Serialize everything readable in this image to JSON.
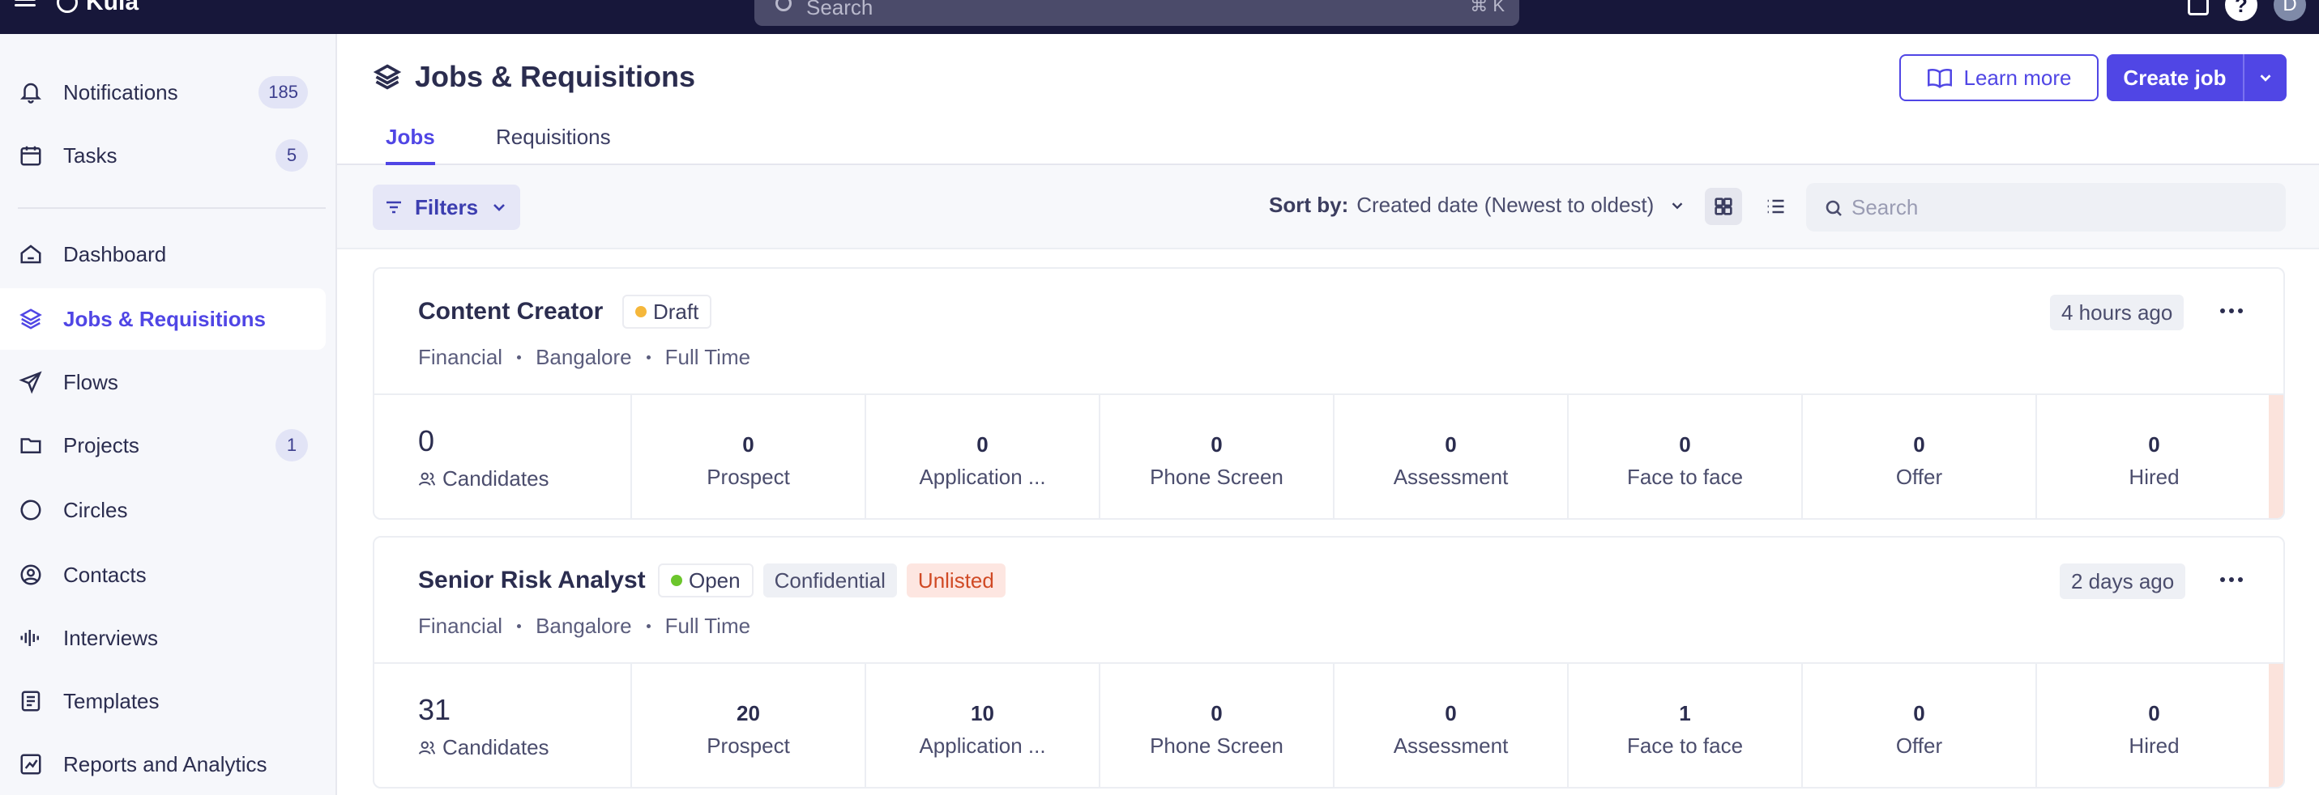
{
  "topbar": {
    "app_name": "Kula",
    "search_placeholder": "Search",
    "search_shortcut": "⌘ K",
    "help_label": "?",
    "avatar_initial": "D"
  },
  "sidebar": {
    "items": [
      {
        "label": "Notifications",
        "icon": "bell-icon",
        "badge": "185"
      },
      {
        "label": "Tasks",
        "icon": "calendar-icon",
        "badge": "5"
      },
      {
        "label": "Dashboard",
        "icon": "home-icon"
      },
      {
        "label": "Jobs & Requisitions",
        "icon": "layers-icon",
        "active": true
      },
      {
        "label": "Flows",
        "icon": "send-icon"
      },
      {
        "label": "Projects",
        "icon": "folder-icon",
        "badge": "1"
      },
      {
        "label": "Circles",
        "icon": "circles-icon"
      },
      {
        "label": "Contacts",
        "icon": "user-circle-icon"
      },
      {
        "label": "Interviews",
        "icon": "waveform-icon"
      },
      {
        "label": "Templates",
        "icon": "templates-icon"
      },
      {
        "label": "Reports and Analytics",
        "icon": "chart-icon"
      }
    ]
  },
  "header": {
    "title": "Jobs & Requisitions",
    "learn_more": "Learn more",
    "create_job": "Create job"
  },
  "tabs": [
    {
      "label": "Jobs",
      "active": true
    },
    {
      "label": "Requisitions",
      "active": false
    }
  ],
  "toolbar": {
    "filters": "Filters",
    "sort_prefix": "Sort by:",
    "sort_value": "Created date (Newest to oldest)",
    "search_placeholder": "Search"
  },
  "jobs": [
    {
      "title": "Content Creator",
      "status": "Draft",
      "status_color": "#f5b73b",
      "tags": [],
      "meta": [
        "Financial",
        "Bangalore",
        "Full Time"
      ],
      "time": "4 hours ago",
      "candidates": "0",
      "candidates_label": "Candidates",
      "stages": [
        {
          "label": "Prospect",
          "count": "0"
        },
        {
          "label": "Application ...",
          "count": "0"
        },
        {
          "label": "Phone Screen",
          "count": "0"
        },
        {
          "label": "Assessment",
          "count": "0"
        },
        {
          "label": "Face to face",
          "count": "0"
        },
        {
          "label": "Offer",
          "count": "0"
        },
        {
          "label": "Hired",
          "count": "0"
        }
      ]
    },
    {
      "title": "Senior Risk Analyst",
      "status": "Open",
      "status_color": "#6cc62c",
      "tags": [
        "Confidential",
        "Unlisted"
      ],
      "meta": [
        "Financial",
        "Bangalore",
        "Full Time"
      ],
      "time": "2 days ago",
      "candidates": "31",
      "candidates_label": "Candidates",
      "stages": [
        {
          "label": "Prospect",
          "count": "20"
        },
        {
          "label": "Application ...",
          "count": "10"
        },
        {
          "label": "Phone Screen",
          "count": "0"
        },
        {
          "label": "Assessment",
          "count": "0"
        },
        {
          "label": "Face to face",
          "count": "1"
        },
        {
          "label": "Offer",
          "count": "0"
        },
        {
          "label": "Hired",
          "count": "0"
        }
      ]
    }
  ],
  "colors": {
    "accent": "#5046e5",
    "topbar": "#17173a",
    "unlisted": "#d04a25"
  }
}
